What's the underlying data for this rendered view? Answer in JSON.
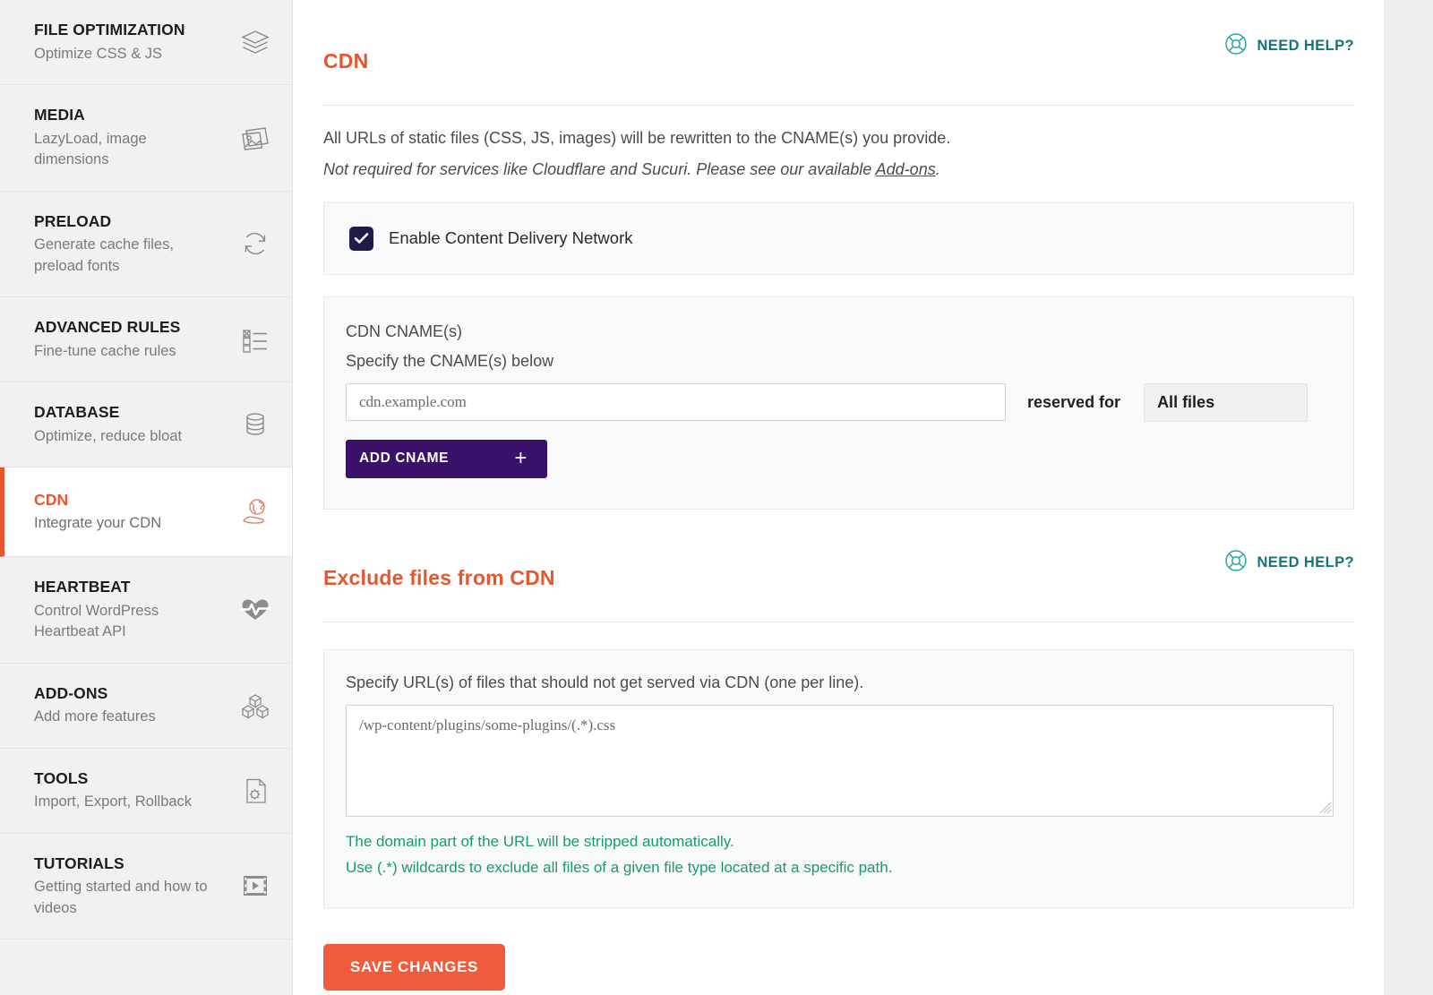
{
  "sidebar": {
    "items": [
      {
        "title": "FILE OPTIMIZATION",
        "desc": "Optimize CSS & JS",
        "icon": "layers-icon",
        "active": false
      },
      {
        "title": "MEDIA",
        "desc": "LazyLoad, image dimensions",
        "icon": "images-icon",
        "active": false
      },
      {
        "title": "PRELOAD",
        "desc": "Generate cache files, preload fonts",
        "icon": "refresh-icon",
        "active": false
      },
      {
        "title": "ADVANCED RULES",
        "desc": "Fine-tune cache rules",
        "icon": "checklist-icon",
        "active": false
      },
      {
        "title": "DATABASE",
        "desc": "Optimize, reduce bloat",
        "icon": "database-icon",
        "active": false
      },
      {
        "title": "CDN",
        "desc": "Integrate your CDN",
        "icon": "globe-hand-icon",
        "active": true
      },
      {
        "title": "HEARTBEAT",
        "desc": "Control WordPress Heartbeat API",
        "icon": "heart-pulse-icon",
        "active": false
      },
      {
        "title": "ADD-ONS",
        "desc": "Add more features",
        "icon": "blocks-icon",
        "active": false
      },
      {
        "title": "TOOLS",
        "desc": "Import, Export, Rollback",
        "icon": "file-gear-icon",
        "active": false
      },
      {
        "title": "TUTORIALS",
        "desc": "Getting started and how to videos",
        "icon": "video-icon",
        "active": false
      }
    ]
  },
  "cdn_section": {
    "title": "CDN",
    "need_help": "NEED HELP?",
    "need_help_icon": "lifebuoy-icon",
    "intro_line1": "All URLs of static files (CSS, JS, images) will be rewritten to the CNAME(s) you provide.",
    "intro_line2_before": "Not required for services like Cloudflare and Sucuri. Please see our available ",
    "intro_link": "Add-ons",
    "intro_line2_after": ".",
    "enable_label": "Enable Content Delivery Network",
    "enable_checked": true,
    "cname_label": "CDN CNAME(s)",
    "cname_sub": "Specify the CNAME(s) below",
    "cname_placeholder": "cdn.example.com",
    "cname_value": "",
    "reserved_for_label": "reserved for",
    "reserved_for_selected": "All files",
    "reserved_for_options": [
      "All files"
    ],
    "add_cname_label": "ADD CNAME",
    "add_cname_plus": "+"
  },
  "exclude_section": {
    "title": "Exclude files from CDN",
    "need_help": "NEED HELP?",
    "need_help_icon": "lifebuoy-icon",
    "desc": "Specify URL(s) of files that should not get served via CDN (one per line).",
    "textarea_placeholder": "/wp-content/plugins/some-plugins/(.*).css",
    "textarea_value": "",
    "hint1": "The domain part of the URL will be stripped automatically.",
    "hint2": "Use (.*) wildcards to exclude all files of a given file type located at a specific path."
  },
  "footer": {
    "save_label": "SAVE CHANGES"
  },
  "colors": {
    "accent_orange": "#e8562f",
    "save_orange": "#ef5b3c",
    "purple": "#3a1169",
    "teal": "#11757a",
    "green_hint": "#1a9a6e",
    "checkbox_navy": "#1f1b4d"
  }
}
